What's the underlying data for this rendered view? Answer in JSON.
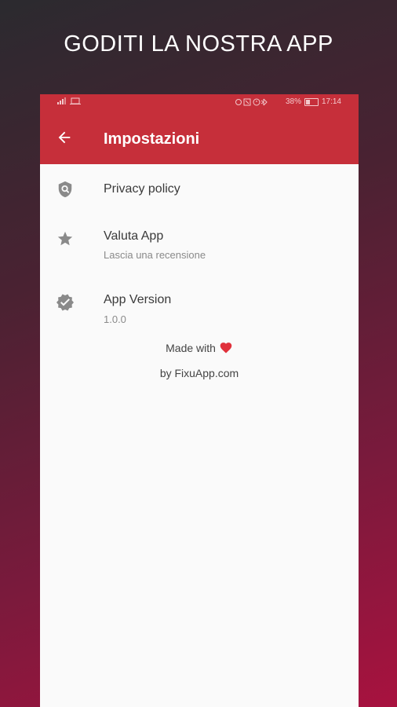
{
  "promo": {
    "headline": "GODITI LA NOSTRA APP"
  },
  "status_bar": {
    "left_icons": "signal-off wifi-off screen",
    "battery_percent": "38%",
    "time": "17:14"
  },
  "app_bar": {
    "title": "Impostazioni",
    "back_icon": "arrow-back-icon",
    "background_color": "#c62f3a"
  },
  "settings": {
    "privacy": {
      "title": "Privacy policy",
      "icon": "shield-search-icon"
    },
    "rate": {
      "title": "Valuta App",
      "subtitle": "Lascia una recensione",
      "icon": "star-icon"
    },
    "version": {
      "title": "App Version",
      "subtitle": "1.0.0",
      "icon": "verified-badge-icon"
    }
  },
  "footer": {
    "made_with": "Made with",
    "heart_icon": "heart-icon",
    "by": "by FixuApp.com"
  }
}
